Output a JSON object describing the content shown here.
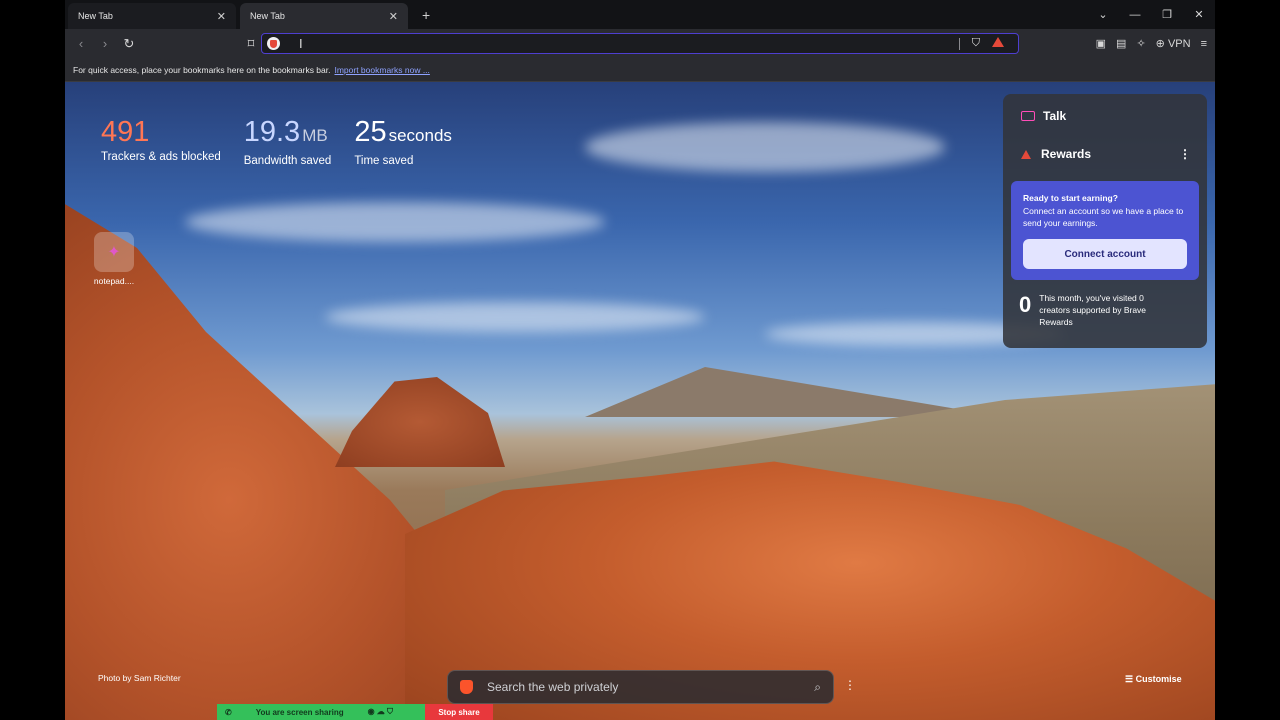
{
  "tabs": [
    {
      "title": "New Tab"
    },
    {
      "title": "New Tab"
    }
  ],
  "new_tab_icon": "+",
  "window_controls": {
    "dropdown": "⌄",
    "minimize": "—",
    "restore": "❐",
    "close": "✕"
  },
  "toolbar": {
    "back_icon": "‹",
    "forward_icon": "›",
    "reload_icon": "↻",
    "bookmark_icon": "⌑",
    "vpn_label": "VPN",
    "menu_icon": "≡"
  },
  "bookmarks_bar": {
    "text": "For quick access, place your bookmarks here on the bookmarks bar.",
    "link": "Import bookmarks now ..."
  },
  "stats": [
    {
      "value": "491",
      "unit": "",
      "label": "Trackers & ads blocked"
    },
    {
      "value": "19.3",
      "unit": "MB",
      "label": "Bandwidth saved"
    },
    {
      "value": "25",
      "unit": "seconds",
      "label": "Time saved"
    }
  ],
  "top_site": {
    "name": "notepad...."
  },
  "widgets": {
    "talk_title": "Talk",
    "rewards_title": "Rewards",
    "rewards_menu_icon": "⋮",
    "earn_heading": "Ready to start earning?",
    "earn_text": "Connect an account so we have a place to send your earnings.",
    "connect_button": "Connect account",
    "visited_count": "0",
    "visited_text": "This month, you've visited 0 creators supported by Brave Rewards"
  },
  "photo_credit": "Photo by Sam Richter",
  "search": {
    "placeholder": "Search the web privately",
    "magnifier_icon": "⌕"
  },
  "more_menu_icon": "⋮",
  "customise_label": "☰ Customise",
  "screen_share": {
    "status": "You are screen sharing",
    "stop": "Stop share"
  },
  "colors": {
    "accent": "#4c54d2",
    "tracker_count": "#ff7654",
    "share_green": "#34c05a",
    "stop_red": "#e8383c"
  }
}
